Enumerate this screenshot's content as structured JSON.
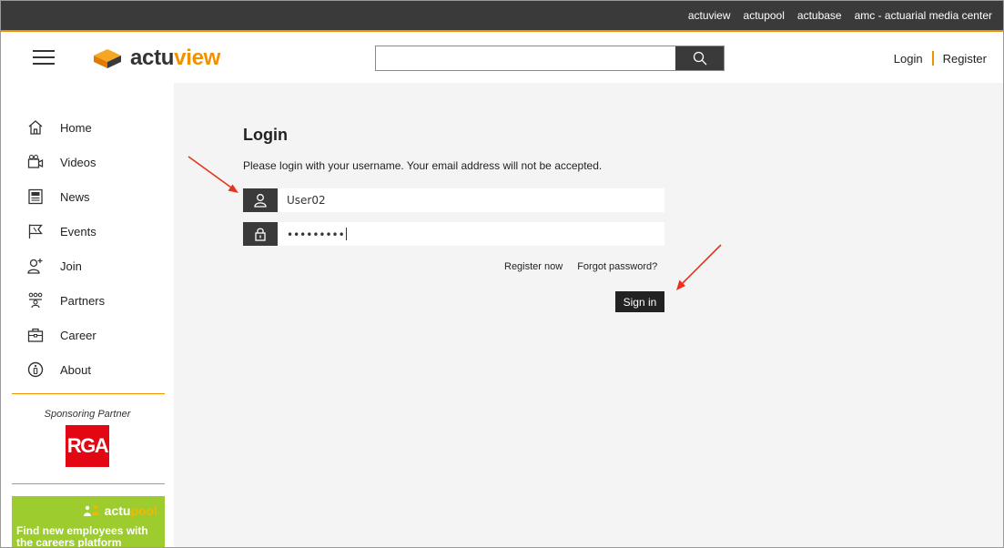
{
  "top_links": [
    "actuview",
    "actupool",
    "actubase",
    "amc - actuarial media center"
  ],
  "logo": {
    "text_a": "actu",
    "text_b": "view"
  },
  "search": {
    "placeholder": "",
    "value": ""
  },
  "auth": {
    "login": "Login",
    "register": "Register"
  },
  "sidebar": {
    "items": [
      {
        "label": "Home",
        "icon": "home-icon"
      },
      {
        "label": "Videos",
        "icon": "video-camera-icon"
      },
      {
        "label": "News",
        "icon": "newspaper-icon"
      },
      {
        "label": "Events",
        "icon": "flag-icon"
      },
      {
        "label": "Join",
        "icon": "add-user-icon"
      },
      {
        "label": "Partners",
        "icon": "partners-icon"
      },
      {
        "label": "Career",
        "icon": "briefcase-icon"
      },
      {
        "label": "About",
        "icon": "info-icon"
      }
    ],
    "sponsor_label": "Sponsoring Partner",
    "sponsor_logo": "RGA",
    "banner": {
      "logo_a": "actu",
      "logo_b": "pool",
      "text": "Find new employees with the careers platform"
    }
  },
  "login": {
    "title": "Login",
    "description": "Please login with your username. Your email address will not be accepted.",
    "username": "User02",
    "password": "•••••••••",
    "register_now": "Register now",
    "forgot_password": "Forgot password?",
    "sign_in": "Sign in"
  },
  "colors": {
    "accent": "#f29100",
    "dark": "#3a3a3a",
    "annotation": "#e8321e",
    "banner": "#9ccc2e",
    "rga": "#e30613"
  }
}
